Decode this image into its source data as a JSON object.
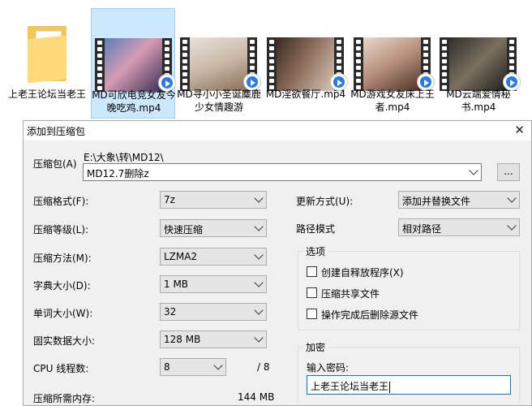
{
  "explorer": {
    "files": [
      {
        "name": "上老王论坛当老王",
        "type": "folder"
      },
      {
        "name": "MD可欣电竞女友今晚吃鸡.mp4",
        "type": "video"
      },
      {
        "name": "MD寻小小圣诞麋鹿少女情趣游",
        "type": "video"
      },
      {
        "name": "MD淫欲餐厅.mp4",
        "type": "video"
      },
      {
        "name": "MD游戏女友床上王者.mp4",
        "type": "video"
      },
      {
        "name": "MD云端爱情秘书.mp4",
        "type": "video"
      }
    ]
  },
  "dialog": {
    "title": "添加到压缩包",
    "archive_label": "压缩包(A)",
    "archive_path": "E:\\大象\\转\\MD12\\",
    "archive_name": "MD12.7删除z",
    "browse_label": "...",
    "left_fields": [
      {
        "label": "压缩格式(F):",
        "value": "7z"
      },
      {
        "label": "压缩等级(L):",
        "value": "快速压缩"
      },
      {
        "label": "压缩方法(M):",
        "value": "LZMA2"
      },
      {
        "label": "字典大小(D):",
        "value": "1 MB"
      },
      {
        "label": "单词大小(W):",
        "value": "32"
      },
      {
        "label": "固实数据大小:",
        "value": "128 MB"
      }
    ],
    "cpu_label": "CPU 线程数:",
    "cpu_value": "8",
    "cpu_total": "/ 8",
    "memory_label": "压缩所需内存:",
    "memory_value": "144 MB",
    "update_label": "更新方式(U):",
    "update_value": "添加并替换文件",
    "path_label": "路径模式",
    "path_value": "相对路径",
    "options_title": "选项",
    "options": [
      {
        "label": "创建自释放程序(X)",
        "checked": false
      },
      {
        "label": "压缩共享文件",
        "checked": false
      },
      {
        "label": "操作完成后删除源文件",
        "checked": false
      }
    ],
    "encryption_title": "加密",
    "password_label": "输入密码:",
    "password_value": "上老王论坛当老王"
  }
}
